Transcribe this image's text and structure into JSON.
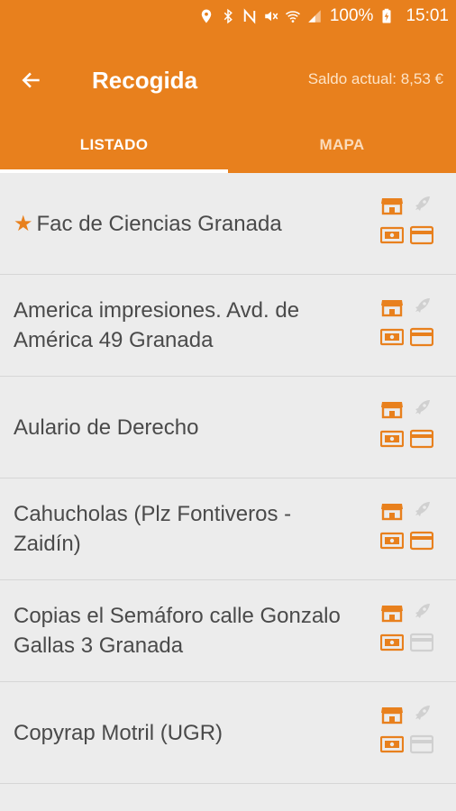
{
  "status_bar": {
    "battery": "100%",
    "time": "15:01",
    "icons": [
      "location-icon",
      "bluetooth-icon",
      "nfc-icon",
      "mute-icon",
      "wifi-icon",
      "signal-icon",
      "battery-charging-icon"
    ]
  },
  "app_bar": {
    "title": "Recogida",
    "balance": "Saldo actual: 8,53 €"
  },
  "tabs": [
    {
      "label": "LISTADO",
      "active": true
    },
    {
      "label": "MAPA",
      "active": false
    }
  ],
  "locations": [
    {
      "name": "Fac de Ciencias Granada",
      "favorite": true,
      "store": true,
      "express": false,
      "cash": true,
      "card": true
    },
    {
      "name": "America impresiones. Avd. de América 49 Granada",
      "favorite": false,
      "store": true,
      "express": false,
      "cash": true,
      "card": true
    },
    {
      "name": "Aulario de Derecho",
      "favorite": false,
      "store": true,
      "express": false,
      "cash": true,
      "card": true
    },
    {
      "name": "Cahucholas (Plz Fontiveros - Zaidín)",
      "favorite": false,
      "store": true,
      "express": false,
      "cash": true,
      "card": true
    },
    {
      "name": "Copias el Semáforo calle Gonzalo Gallas 3 Granada",
      "favorite": false,
      "store": true,
      "express": false,
      "cash": true,
      "card": false
    },
    {
      "name": "Copyrap Motril (UGR)",
      "favorite": false,
      "store": true,
      "express": false,
      "cash": true,
      "card": false
    }
  ],
  "colors": {
    "accent": "#e8801d",
    "icon_active": "#e8801d",
    "icon_inactive": "#d0d0d0",
    "text": "#4a4a4a"
  }
}
